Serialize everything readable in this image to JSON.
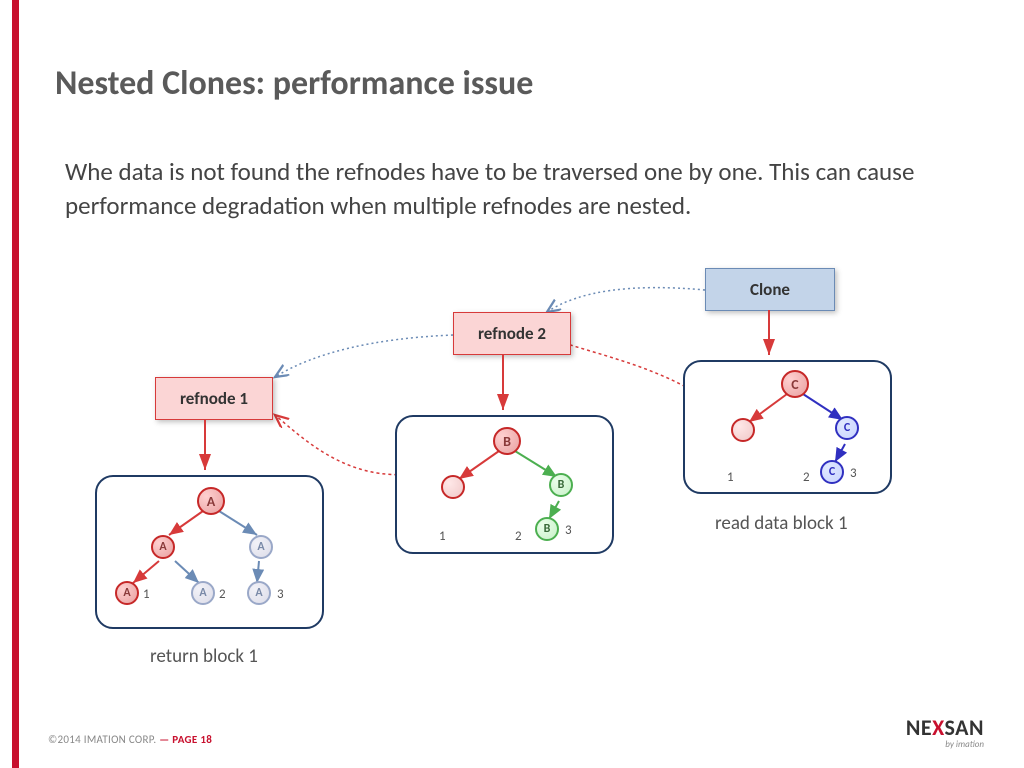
{
  "title": "Nested Clones: performance issue",
  "body": "Whe data is not found the refnodes have to be traversed one by one. This can cause performance degradation when multiple refnodes are nested.",
  "boxes": {
    "clone": "Clone",
    "refnode2": "refnode 2",
    "refnode1": "refnode 1"
  },
  "captions": {
    "left": "return block 1",
    "right": "read data block 1"
  },
  "nodes": {
    "a": "A",
    "b": "B",
    "c": "C"
  },
  "nums": {
    "n1": "1",
    "n2": "2",
    "n3": "3"
  },
  "footer": {
    "copyright": "©2014 IMATION CORP.",
    "dash": "—",
    "page_label": "PAGE",
    "page_num": "18"
  },
  "logo": {
    "n": "N",
    "e": "E",
    "x": "X",
    "s": "S",
    "a": "A",
    "n2": "N",
    "by": "by imation"
  }
}
